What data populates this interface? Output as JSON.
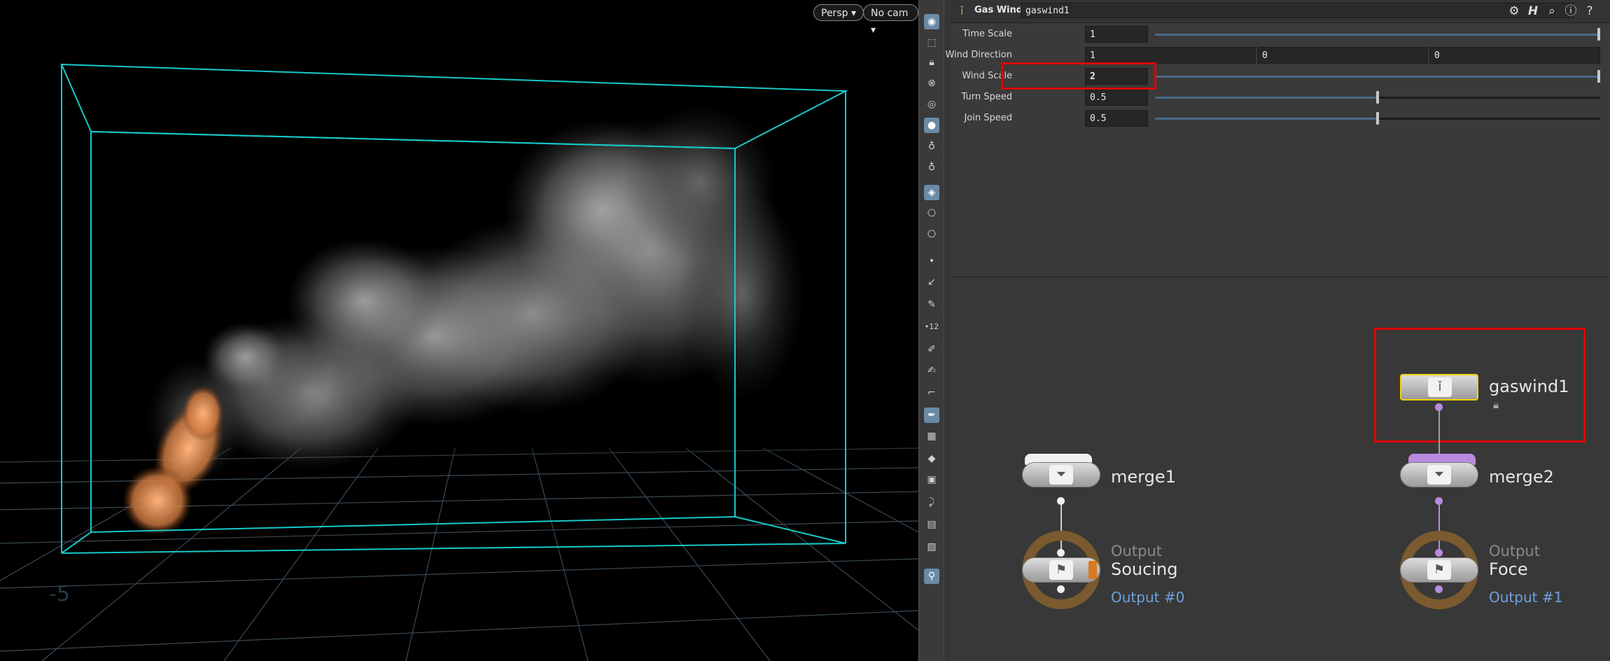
{
  "viewport": {
    "camera_menu": "Persp",
    "cam_menu": "No cam",
    "colors": {
      "bbox": "#19c8c8",
      "grid": "#3a4a55",
      "smoke": "#9a9a9a",
      "fire": "#e08a50"
    }
  },
  "toolbar": {
    "icons": [
      "eye-icon",
      "select-icon",
      "lock-icon",
      "ghost-icon",
      "snap-icon",
      "light-icon",
      "bulb-icon",
      "bulb-alt-icon",
      "color-icon",
      "camera-icon",
      "camera-alt-icon",
      "point-icon",
      "vector-icon",
      "pen-icon",
      "number-icon",
      "brush-icon",
      "paint-icon",
      "bend-icon",
      "pen-alt-icon",
      "checker-icon",
      "diamond-icon",
      "image-icon",
      "bone-icon",
      "box-icon",
      "picture-icon",
      "pin-icon"
    ]
  },
  "params": {
    "node_type": "Gas Wind",
    "node_name": "gaswind1",
    "rows": [
      {
        "label": "Time Scale",
        "value": "1",
        "slider": 1.0
      },
      {
        "label": "Wind Direction",
        "x": "1",
        "y": "0",
        "z": "0"
      },
      {
        "label": "Wind Scale",
        "value": "2",
        "slider": 1.0
      },
      {
        "label": "Turn Speed",
        "value": "0.5",
        "slider": 0.5
      },
      {
        "label": "Join Speed",
        "value": "0.5",
        "slider": 0.5
      }
    ],
    "highlight_color": "#e00000"
  },
  "network": {
    "gaswind": {
      "name": "gaswind1"
    },
    "merge1": {
      "name": "merge1"
    },
    "merge2": {
      "name": "merge2"
    },
    "out0": {
      "type": "Output",
      "name": "Soucing",
      "link": "Output #0"
    },
    "out1": {
      "type": "Output",
      "name": "Foce",
      "link": "Output #1"
    },
    "colors": {
      "wire_white": "#cfcfcf",
      "wire_purple": "#b88be0",
      "output_ring": "#7a5a2e",
      "selected": "#f0d000",
      "link": "#6fa0e0"
    }
  }
}
